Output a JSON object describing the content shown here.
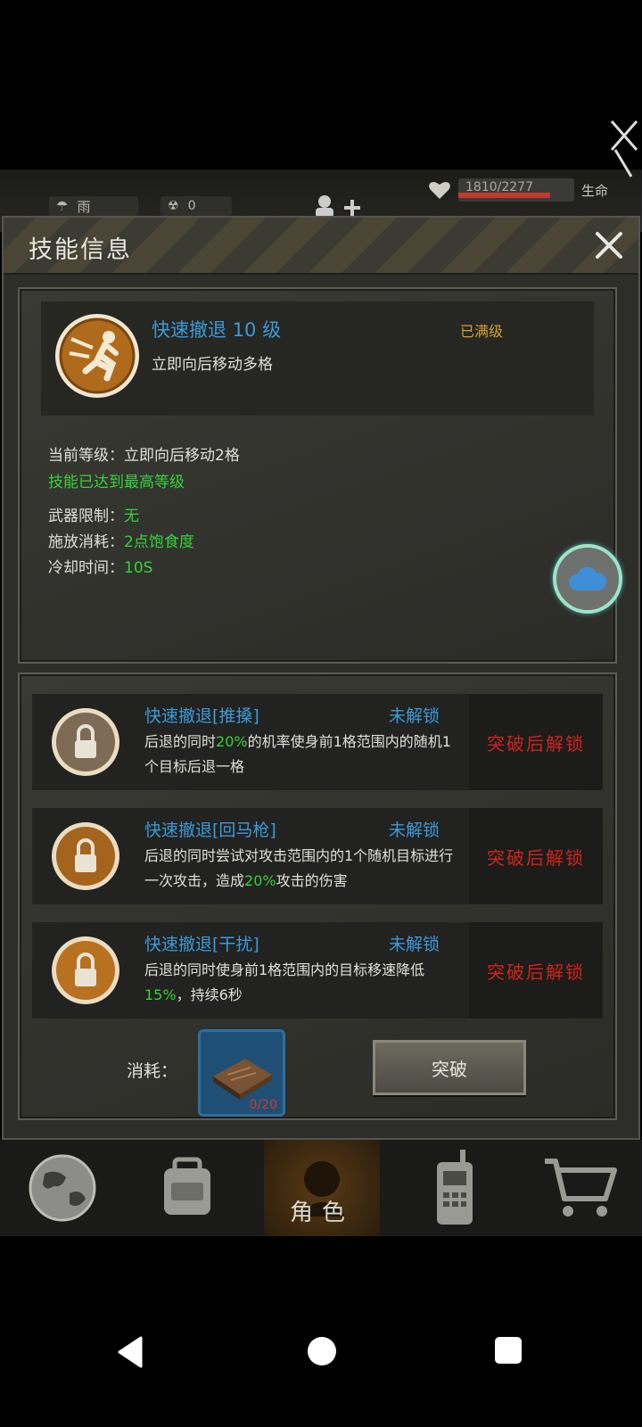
{
  "hud": {
    "weather": "雨",
    "radiation": "0",
    "hp_text": "1810/2277",
    "hp_fraction": 0.795,
    "hp_label": "生命"
  },
  "dialog": {
    "title": "技能信息",
    "skill": {
      "name": "快速撤退 10 级",
      "status": "已满级",
      "desc": "立即向后移动多格"
    },
    "current_level_label": "当前等级：",
    "current_level_value": "立即向后移动2格",
    "max_note": "技能已达到最高等级",
    "weapon_label": "武器限制：",
    "weapon_value": "无",
    "cast_label": "施放消耗：",
    "cast_value": "2点饱食度",
    "cooldown_label": "冷却时间：",
    "cooldown_value": "10S",
    "subskills": [
      {
        "name": "快速撤退[推搡]",
        "status": "未解锁",
        "desc_a": "后退的同时",
        "desc_pct": "20%",
        "desc_b": "的机率使身前1格范围内的随机1个目标后退一格",
        "lock": "突破后解锁"
      },
      {
        "name": "快速撤退[回马枪]",
        "status": "未解锁",
        "desc_a": "后退的同时尝试对攻击范围内的1个随机目标进行一次攻击，造成",
        "desc_pct": "20%",
        "desc_b": "攻击的伤害",
        "lock": "突破后解锁"
      },
      {
        "name": "快速撤退[干扰]",
        "status": "未解锁",
        "desc_a": "后退的同时使身前1格范围内的目标移速降低",
        "desc_pct": "15%",
        "desc_b": "，持续6秒",
        "lock": "突破后解锁"
      }
    ],
    "cost_label": "消耗：",
    "cost_count": "0/20",
    "break_button": "突破"
  },
  "nav": {
    "character_label": "角色"
  },
  "colors": {
    "skill_blue": "#3b9ad8",
    "max_gold": "#d2a02f",
    "green": "#35d23a",
    "lock_red": "#d1241b"
  }
}
